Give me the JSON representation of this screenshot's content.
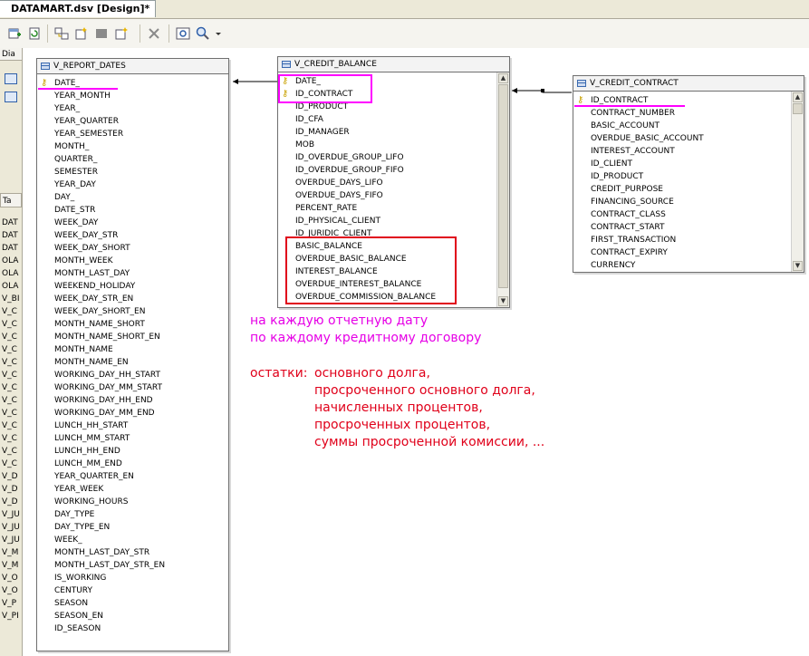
{
  "document_tab": {
    "title": "DATAMART.dsv [Design]*"
  },
  "left_pane": {
    "header": "Dia",
    "tables_header": "Ta",
    "items": [
      "DAT",
      "DAT",
      "DAT",
      "OLA",
      "OLA",
      "OLA",
      "V_BI",
      "V_C",
      "V_C",
      "V_C",
      "V_C",
      "V_C",
      "V_C",
      "V_C",
      "V_C",
      "V_C",
      "V_C",
      "V_C",
      "V_C",
      "V_C",
      "V_D",
      "V_D",
      "V_D",
      "V_JU",
      "V_JU",
      "V_JU",
      "V_M",
      "V_M",
      "V_O",
      "V_O",
      "V_P",
      "V_PI"
    ]
  },
  "tables": {
    "report_dates": {
      "name": "V_REPORT_DATES",
      "columns": [
        "DATE_",
        "YEAR_MONTH",
        "YEAR_",
        "YEAR_QUARTER",
        "YEAR_SEMESTER",
        "MONTH_",
        "QUARTER_",
        "SEMESTER",
        "YEAR_DAY",
        "DAY_",
        "DATE_STR",
        "WEEK_DAY",
        "WEEK_DAY_STR",
        "WEEK_DAY_SHORT",
        "MONTH_WEEK",
        "MONTH_LAST_DAY",
        "WEEKEND_HOLIDAY",
        "WEEK_DAY_STR_EN",
        "WEEK_DAY_SHORT_EN",
        "MONTH_NAME_SHORT",
        "MONTH_NAME_SHORT_EN",
        "MONTH_NAME",
        "MONTH_NAME_EN",
        "WORKING_DAY_HH_START",
        "WORKING_DAY_MM_START",
        "WORKING_DAY_HH_END",
        "WORKING_DAY_MM_END",
        "LUNCH_HH_START",
        "LUNCH_MM_START",
        "LUNCH_HH_END",
        "LUNCH_MM_END",
        "YEAR_QUARTER_EN",
        "YEAR_WEEK",
        "WORKING_HOURS",
        "DAY_TYPE",
        "DAY_TYPE_EN",
        "WEEK_",
        "MONTH_LAST_DAY_STR",
        "MONTH_LAST_DAY_STR_EN",
        "IS_WORKING",
        "CENTURY",
        "SEASON",
        "SEASON_EN",
        "ID_SEASON"
      ]
    },
    "credit_balance": {
      "name": "V_CREDIT_BALANCE",
      "columns": [
        "DATE_",
        "ID_CONTRACT",
        "ID_PRODUCT",
        "ID_CFA",
        "ID_MANAGER",
        "MOB",
        "ID_OVERDUE_GROUP_LIFO",
        "ID_OVERDUE_GROUP_FIFO",
        "OVERDUE_DAYS_LIFO",
        "OVERDUE_DAYS_FIFO",
        "PERCENT_RATE",
        "ID_PHYSICAL_CLIENT",
        "ID_JURIDIC_CLIENT",
        "BASIC_BALANCE",
        "OVERDUE_BASIC_BALANCE",
        "INTEREST_BALANCE",
        "OVERDUE_INTEREST_BALANCE",
        "OVERDUE_COMMISSION_BALANCE"
      ]
    },
    "credit_contract": {
      "name": "V_CREDIT_CONTRACT",
      "columns": [
        "ID_CONTRACT",
        "CONTRACT_NUMBER",
        "BASIC_ACCOUNT",
        "OVERDUE_BASIC_ACCOUNT",
        "INTEREST_ACCOUNT",
        "ID_CLIENT",
        "ID_PRODUCT",
        "CREDIT_PURPOSE",
        "FINANCING_SOURCE",
        "CONTRACT_CLASS",
        "CONTRACT_START",
        "FIRST_TRANSACTION",
        "CONTRACT_EXPIRY",
        "CURRENCY"
      ]
    }
  },
  "annotations": {
    "pink_lines": [
      "на каждую отчетную дату",
      "по каждому кредитному договору"
    ],
    "red_label": "остатки:",
    "red_lines": [
      "основного долга,",
      "просроченного основного долга,",
      "начисленных процентов,",
      "просроченных процентов,",
      "суммы просроченной комиссии, ..."
    ]
  },
  "colors": {
    "highlight_pink": "#ff00ff",
    "highlight_red": "#e0001a",
    "key_icon": "#c9a200"
  },
  "icons": [
    "key-icon",
    "table-icon",
    "scroll-up-icon",
    "scroll-down-icon",
    "zoom-icon",
    "delete-icon"
  ]
}
